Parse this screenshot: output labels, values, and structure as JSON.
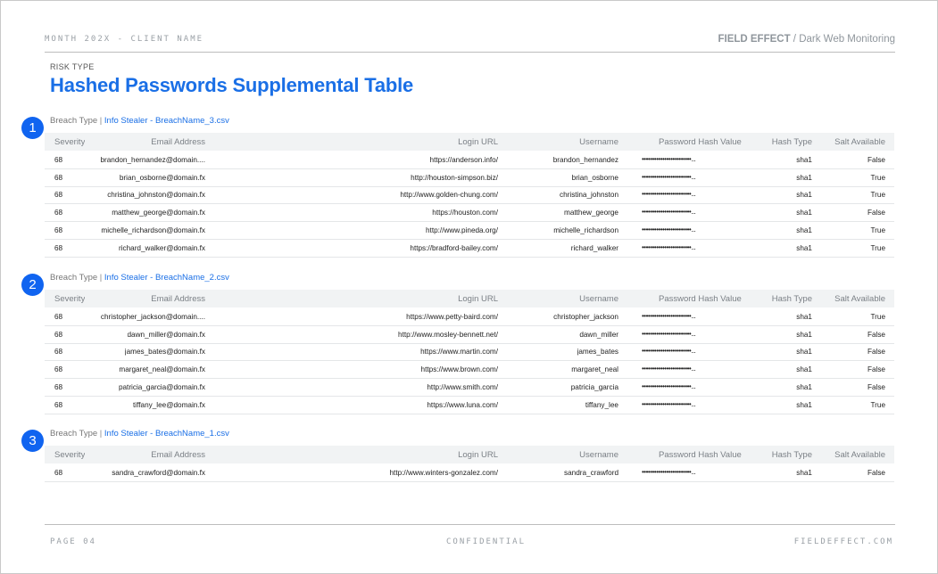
{
  "header": {
    "left": "MONTH 202X - CLIENT NAME",
    "brand": "FIELD EFFECT",
    "product": " / Dark Web Monitoring"
  },
  "risk_type_label": "RISK TYPE",
  "title": "Hashed Passwords Supplemental Table",
  "columns": {
    "severity": "Severity",
    "email": "Email Address",
    "url": "Login URL",
    "username": "Username",
    "password": "Password Hash Value",
    "hash_type": "Hash Type",
    "salt": "Salt Available"
  },
  "sections": [
    {
      "number": "1",
      "breach_label": "Breach Type",
      "breach_file": "Info Stealer - BreachName_3.csv",
      "rows": [
        {
          "severity": "68",
          "email": "brandon_hernandez@domain....",
          "url": "https://anderson.info/",
          "username": "brandon_hernandez",
          "password": "••••••••••••••••••••••••...",
          "hash_type": "sha1",
          "salt": "False"
        },
        {
          "severity": "68",
          "email": "brian_osborne@domain.fx",
          "url": "http://houston-simpson.biz/",
          "username": "brian_osborne",
          "password": "••••••••••••••••••••••••...",
          "hash_type": "sha1",
          "salt": "True"
        },
        {
          "severity": "68",
          "email": "christina_johnston@domain.fx",
          "url": "http://www.golden-chung.com/",
          "username": "christina_johnston",
          "password": "••••••••••••••••••••••••...",
          "hash_type": "sha1",
          "salt": "True"
        },
        {
          "severity": "68",
          "email": "matthew_george@domain.fx",
          "url": "https://houston.com/",
          "username": "matthew_george",
          "password": "••••••••••••••••••••••••...",
          "hash_type": "sha1",
          "salt": "False"
        },
        {
          "severity": "68",
          "email": "michelle_richardson@domain.fx",
          "url": "http://www.pineda.org/",
          "username": "michelle_richardson",
          "password": "••••••••••••••••••••••••...",
          "hash_type": "sha1",
          "salt": "True"
        },
        {
          "severity": "68",
          "email": "richard_walker@domain.fx",
          "url": "https://bradford-bailey.com/",
          "username": "richard_walker",
          "password": "••••••••••••••••••••••••...",
          "hash_type": "sha1",
          "salt": "True"
        }
      ]
    },
    {
      "number": "2",
      "breach_label": "Breach Type",
      "breach_file": "Info Stealer - BreachName_2.csv",
      "rows": [
        {
          "severity": "68",
          "email": "christopher_jackson@domain....",
          "url": "https://www.petty-baird.com/",
          "username": "christopher_jackson",
          "password": "••••••••••••••••••••••••...",
          "hash_type": "sha1",
          "salt": "True"
        },
        {
          "severity": "68",
          "email": "dawn_miller@domain.fx",
          "url": "http://www.mosley-bennett.net/",
          "username": "dawn_miller",
          "password": "••••••••••••••••••••••••...",
          "hash_type": "sha1",
          "salt": "False"
        },
        {
          "severity": "68",
          "email": "james_bates@domain.fx",
          "url": "https://www.martin.com/",
          "username": "james_bates",
          "password": "••••••••••••••••••••••••...",
          "hash_type": "sha1",
          "salt": "False"
        },
        {
          "severity": "68",
          "email": "margaret_neal@domain.fx",
          "url": "https://www.brown.com/",
          "username": "margaret_neal",
          "password": "••••••••••••••••••••••••...",
          "hash_type": "sha1",
          "salt": "False"
        },
        {
          "severity": "68",
          "email": "patricia_garcia@domain.fx",
          "url": "http://www.smith.com/",
          "username": "patricia_garcia",
          "password": "••••••••••••••••••••••••...",
          "hash_type": "sha1",
          "salt": "False"
        },
        {
          "severity": "68",
          "email": "tiffany_lee@domain.fx",
          "url": "https://www.luna.com/",
          "username": "tiffany_lee",
          "password": "••••••••••••••••••••••••...",
          "hash_type": "sha1",
          "salt": "True"
        }
      ]
    },
    {
      "number": "3",
      "breach_label": "Breach Type",
      "breach_file": "Info Stealer - BreachName_1.csv",
      "rows": [
        {
          "severity": "68",
          "email": "sandra_crawford@domain.fx",
          "url": "http://www.winters-gonzalez.com/",
          "username": "sandra_crawford",
          "password": "••••••••••••••••••••••••...",
          "hash_type": "sha1",
          "salt": "False"
        }
      ]
    }
  ],
  "footer": {
    "page": "PAGE 04",
    "confidential": "CONFIDENTIAL",
    "site": "FIELDEFFECT.COM"
  }
}
